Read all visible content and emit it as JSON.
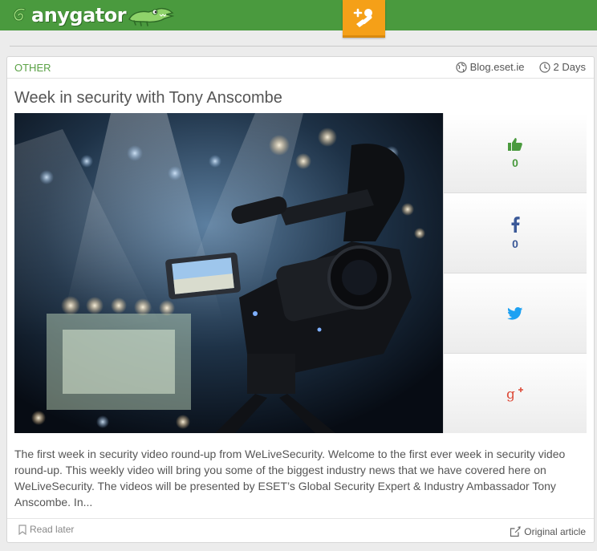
{
  "brand": {
    "name": "anygator",
    "color": "#4a9a3e"
  },
  "topbar": {
    "center_icon": "profile-add-icon",
    "center_color": "#f5a018"
  },
  "article": {
    "category": "OTHER",
    "source": "Blog.eset.ie",
    "age": "2 Days",
    "title": "Week in security with Tony Anscombe",
    "image_subject": "camera-icon",
    "excerpt": "The first week in security video round-up from WeLiveSecurity. Welcome to the first ever week in security video round-up. This weekly video will bring you some of the biggest industry news that we have covered here on WeLiveSecurity. The videos will be presented by ESET’s Global Security Expert & Industry Ambassador Tony Anscombe. In...",
    "read_later": "Read later",
    "original_article": "Original article"
  },
  "share": {
    "likes": "0",
    "facebook": "0",
    "colors": {
      "like": "#4a9a3e",
      "facebook": "#3b5998",
      "twitter": "#1da1f2",
      "gplus": "#dd4b39"
    }
  }
}
